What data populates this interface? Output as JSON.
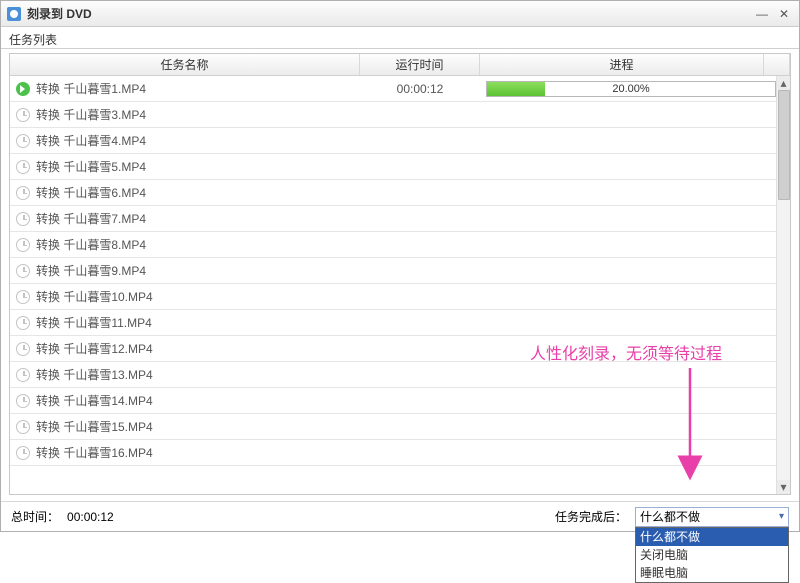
{
  "window": {
    "title": "刻录到 DVD"
  },
  "subtitle": "任务列表",
  "columns": {
    "name": "任务名称",
    "time": "运行时间",
    "progress": "进程"
  },
  "tasks": [
    {
      "name": "转换 千山暮雪1.MP4",
      "time": "00:00:12",
      "progress_pct": 20.0,
      "active": true
    },
    {
      "name": "转换 千山暮雪3.MP4",
      "time": "",
      "progress_pct": null,
      "active": false
    },
    {
      "name": "转换 千山暮雪4.MP4",
      "time": "",
      "progress_pct": null,
      "active": false
    },
    {
      "name": "转换 千山暮雪5.MP4",
      "time": "",
      "progress_pct": null,
      "active": false
    },
    {
      "name": "转换 千山暮雪6.MP4",
      "time": "",
      "progress_pct": null,
      "active": false
    },
    {
      "name": "转换 千山暮雪7.MP4",
      "time": "",
      "progress_pct": null,
      "active": false
    },
    {
      "name": "转换 千山暮雪8.MP4",
      "time": "",
      "progress_pct": null,
      "active": false
    },
    {
      "name": "转换 千山暮雪9.MP4",
      "time": "",
      "progress_pct": null,
      "active": false
    },
    {
      "name": "转换 千山暮雪10.MP4",
      "time": "",
      "progress_pct": null,
      "active": false
    },
    {
      "name": "转换 千山暮雪11.MP4",
      "time": "",
      "progress_pct": null,
      "active": false
    },
    {
      "name": "转换 千山暮雪12.MP4",
      "time": "",
      "progress_pct": null,
      "active": false
    },
    {
      "name": "转换 千山暮雪13.MP4",
      "time": "",
      "progress_pct": null,
      "active": false
    },
    {
      "name": "转换 千山暮雪14.MP4",
      "time": "",
      "progress_pct": null,
      "active": false
    },
    {
      "name": "转换 千山暮雪15.MP4",
      "time": "",
      "progress_pct": null,
      "active": false
    },
    {
      "name": "转换 千山暮雪16.MP4",
      "time": "",
      "progress_pct": null,
      "active": false
    }
  ],
  "progress_text": "20.00%",
  "footer": {
    "total_time_label": "总时间：",
    "total_time_value": "00:00:12",
    "after_label": "任务完成后：",
    "select_value": "什么都不做",
    "options": [
      "什么都不做",
      "关闭电脑",
      "睡眠电脑"
    ]
  },
  "annotation": "人性化刻录，无须等待过程",
  "colors": {
    "progress_fill": "#5cc233",
    "dropdown_selected": "#2a5db0",
    "annotation": "#e83fa8"
  }
}
